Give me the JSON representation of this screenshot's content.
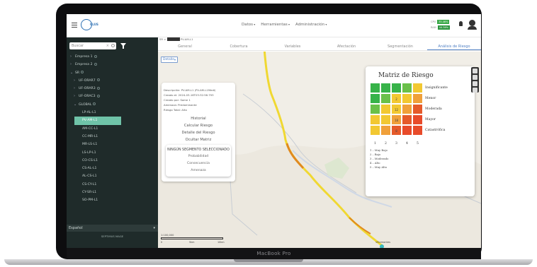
{
  "device": {
    "label": "MacBook Pro"
  },
  "topbar": {
    "logo_text": "GLUS",
    "nav": [
      "Datos",
      "Herramientas",
      "Administración"
    ],
    "stats": [
      {
        "label": "CPU",
        "value": "35.46%"
      },
      {
        "label": "RAM",
        "value": "44.38%"
      }
    ]
  },
  "sidebar": {
    "search_placeholder": "Buscar",
    "tree": [
      {
        "label": "Empresa 1",
        "caret": "›",
        "indent": 1
      },
      {
        "label": "Empresa 2",
        "caret": "›",
        "indent": 1
      },
      {
        "label": "SR",
        "caret": "⌄",
        "indent": 1
      },
      {
        "label": "UF-ORAR7",
        "caret": "›",
        "indent": 2
      },
      {
        "label": "UF-ORAR3",
        "caret": "›",
        "indent": 2
      },
      {
        "label": "UF-ORAC3",
        "caret": "›",
        "indent": 2
      },
      {
        "label": "GLOBAL",
        "caret": "⌄",
        "indent": 2
      },
      {
        "label": "LP-AL-L1",
        "caret": "",
        "indent": 3
      },
      {
        "label": "PV-AM-L1",
        "caret": "",
        "indent": 3,
        "selected": true
      },
      {
        "label": "AM-CC-L1",
        "caret": "",
        "indent": 3
      },
      {
        "label": "CC-MR-L1",
        "caret": "",
        "indent": 3
      },
      {
        "label": "MR-LS-L1",
        "caret": "",
        "indent": 3
      },
      {
        "label": "LS-LP-L1",
        "caret": "",
        "indent": 3
      },
      {
        "label": "CO-CS-L1",
        "caret": "",
        "indent": 3
      },
      {
        "label": "CS-AL-L1",
        "caret": "",
        "indent": 3
      },
      {
        "label": "AL-CS-L1",
        "caret": "",
        "indent": 3
      },
      {
        "label": "CS-CY-L1",
        "caret": "",
        "indent": 3
      },
      {
        "label": "CY-SR-L1",
        "caret": "",
        "indent": 3
      },
      {
        "label": "SO-PM-L1",
        "caret": "",
        "indent": 3
      }
    ],
    "language": "Español",
    "footer": "SEPTIMUS MAGE"
  },
  "main": {
    "breadcrumb_pre": "SR >",
    "breadcrumb_post": "PV-AM-L1",
    "tabs": [
      {
        "label": "General",
        "active": false
      },
      {
        "label": "Cobertura",
        "active": false
      },
      {
        "label": "Variables",
        "active": false
      },
      {
        "label": "Afectación",
        "active": false
      },
      {
        "label": "Segmentación",
        "active": false
      },
      {
        "label": "Análisis de Riesgo",
        "active": true
      }
    ],
    "toggle_label": "Detalle",
    "info": {
      "lines": [
        "Descripción: PV-AM-L1 (PV-AM-L1Medi)",
        "Creado el: 2024-03-16T03:32:56.793",
        "Creado por: Some 1",
        "Amenaza: Predominante",
        "Riesgo Total: Alto"
      ],
      "buttons": [
        "Historial",
        "Calcular Riesgo",
        "Detalle del Riesgo",
        "Ocultar Matriz"
      ]
    },
    "segment": {
      "title": "NINGÚN SEGMENTO SELECCIONADO",
      "options": [
        "Probabilidad",
        "Consecuencia",
        "Amenaza"
      ]
    },
    "scale": {
      "label": "1:100,000",
      "ticks": [
        "0",
        "5km",
        "10km"
      ]
    },
    "map_places": [
      "Villamontes"
    ]
  },
  "matrix": {
    "title": "Matriz de Riesgo",
    "rows": [
      "Insignificante",
      "Menor",
      "Moderada",
      "Mayor",
      "Catastrófica"
    ],
    "x_axis": [
      "1",
      "2",
      "3",
      "4",
      "5"
    ],
    "cells": [
      [
        "#37b349",
        "#37b349",
        "#37b349",
        "#6ac04a",
        "#f2c832"
      ],
      [
        "#37b349",
        "#6ac04a",
        "#f2c832",
        "#f2c832",
        "#f0a03a"
      ],
      [
        "#6ac04a",
        "#f2c832",
        "#f2c832",
        "#f0a03a",
        "#e55a2a"
      ],
      [
        "#f2c832",
        "#f2c832",
        "#f0a03a",
        "#e55a2a",
        "#e84b2a"
      ],
      [
        "#f2c832",
        "#f0a03a",
        "#e55a2a",
        "#e84b2a",
        "#e84b2a"
      ]
    ],
    "marks": [
      {
        "row": 1,
        "col": 2,
        "text": "2"
      },
      {
        "row": 2,
        "col": 2,
        "text": "12"
      },
      {
        "row": 3,
        "col": 2,
        "text": "18"
      },
      {
        "row": 4,
        "col": 2,
        "text": "8"
      }
    ],
    "legend": [
      "1 – Muy Bajo",
      "2 – Bajo",
      "3 – Moderado",
      "4 – Alto",
      "5 – Muy Alto"
    ]
  }
}
